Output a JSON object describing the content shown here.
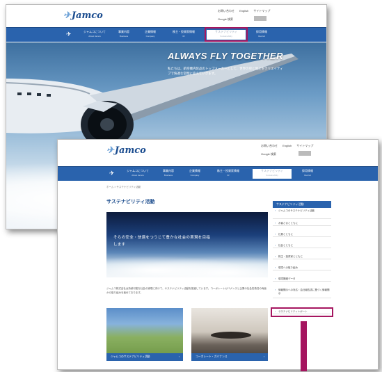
{
  "back": {
    "logo": "Jamco",
    "util_links": [
      "お問い合わせ",
      "English",
      "サイトマップ"
    ],
    "lang": "Google 検索",
    "nav": [
      {
        "label": "ジャムコについて",
        "sub": "About Jamco"
      },
      {
        "label": "事業内容",
        "sub": "Business"
      },
      {
        "label": "企業情報",
        "sub": "Company"
      },
      {
        "label": "株主・投資家情報",
        "sub": "IR"
      },
      {
        "label": "サステナビリティ",
        "sub": "Sustainability"
      },
      {
        "label": "採用情報",
        "sub": "Recruit"
      }
    ],
    "tagline": "ALWAYS FLY TOGETHER",
    "tag_sub": "私たちは、航空機内装品のトップメーカーとして、世界の空と地上をクリエイティブで快適な空間に変えていきます。"
  },
  "front": {
    "logo": "Jamco",
    "util_links": [
      "お問い合わせ",
      "English",
      "サイトマップ"
    ],
    "lang": "Google 検索",
    "nav": [
      {
        "label": "ジャムコについて",
        "sub": "About Jamco"
      },
      {
        "label": "事業内容",
        "sub": "Business"
      },
      {
        "label": "企業情報",
        "sub": "Company"
      },
      {
        "label": "株主・投資家情報",
        "sub": "IR"
      },
      {
        "label": "サステナビリティ",
        "sub": "Sustainability"
      },
      {
        "label": "採用情報",
        "sub": "Recruit"
      }
    ],
    "breadcrumb": "ホーム > サステナビリティ活動",
    "page_title": "サステナビリティ活動",
    "img_caption": "そらの安全・快適をつうじて豊かな社会の実現を目指します",
    "intro": "ジャムコ株式会社は持続可能な社会の実現に向けて、サステナビリティ活動を推進しています。コーポレートガバナンスと企業の社会的責任の両面から取り組みを進めております。",
    "thumbs": [
      {
        "caption": "ジャムコのサステナビリティ活動",
        "arrow": "›"
      },
      {
        "caption": "コーポレート・ガバナンス",
        "arrow": "›"
      }
    ],
    "side_head": "サステナビリティ活動",
    "side_items": [
      "ジャムコのサステナビリティ活動",
      "お客さまとともに",
      "社員とともに",
      "社会とともに",
      "株主・投資家とともに",
      "環境への取り組み",
      "環境関連データ",
      "情報開示への対応・会社報告書に基づく情報開示",
      "サステナビリティレポート"
    ]
  },
  "colors": {
    "nav": "#2a63ad",
    "highlight": "#a5155f"
  }
}
